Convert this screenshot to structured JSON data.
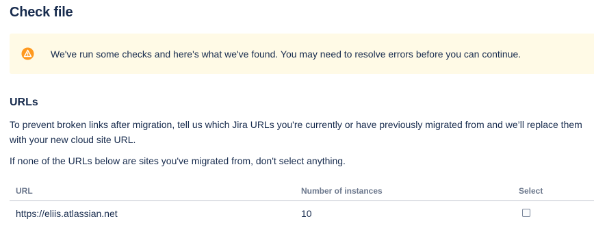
{
  "page": {
    "title": "Check file"
  },
  "warning": {
    "icon": "warning-icon",
    "color": "#ff991f",
    "background": "#fffae6",
    "message": "We've run some checks and here's what we've found. You may need to resolve errors before you can continue."
  },
  "urls_section": {
    "heading": "URLs",
    "description": "To prevent broken links after migration, tell us which Jira URLs you're currently or have previously migrated from and we’ll replace them with your new cloud site URL.",
    "note": "If none of the URLs below are sites you've migrated from, don't select anything."
  },
  "table": {
    "columns": [
      "URL",
      "Number of instances",
      "Select"
    ],
    "rows": [
      {
        "url": "https://eliis.atlassian.net",
        "instances": "10",
        "selected": false
      }
    ]
  }
}
